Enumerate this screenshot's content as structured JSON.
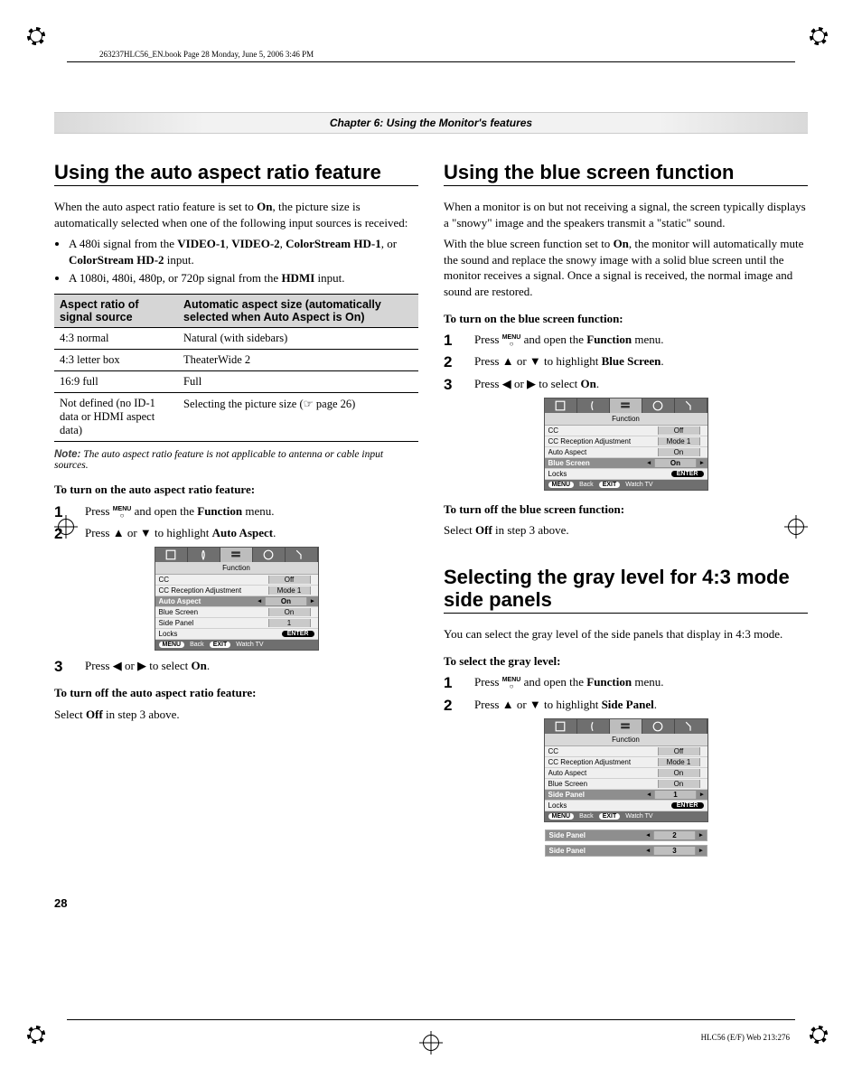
{
  "book_header": "263237HLC56_EN.book  Page 28  Monday, June 5, 2006  3:46 PM",
  "running_head": "Chapter 6: Using the Monitor's features",
  "page_number": "28",
  "footer_right": "HLC56 (E/F) Web 213:276",
  "left": {
    "h1": "Using the auto aspect ratio feature",
    "intro_a": "When the auto aspect ratio feature is set to ",
    "intro_b": "On",
    "intro_c": ", the picture size is automatically selected when one of the following input sources is received:",
    "bullets": [
      {
        "pre": "A 480i signal from the ",
        "b1": "VIDEO-1",
        "mid1": ", ",
        "b2": "VIDEO-2",
        "mid2": ", ",
        "b3": "ColorStream HD-1",
        "mid3": ", or ",
        "b4": "ColorStream HD-2",
        "post": " input."
      },
      {
        "pre": "A 1080i, 480i, 480p, or 720p signal from the ",
        "b1": "HDMI",
        "post": " input."
      }
    ],
    "table": {
      "col1": "Aspect ratio of signal source",
      "col2": "Automatic aspect size (automatically selected when Auto Aspect is On)",
      "rows": [
        {
          "c1": "4:3 normal",
          "c2": "Natural (with sidebars)"
        },
        {
          "c1": "4:3 letter box",
          "c2": "TheaterWide 2"
        },
        {
          "c1": "16:9 full",
          "c2": "Full"
        },
        {
          "c1": "Not defined (no ID-1 data or HDMI aspect data)",
          "c2": "Selecting the picture size (☞ page 26)"
        }
      ]
    },
    "note_label": "Note:",
    "note_text": " The auto aspect ratio feature is not applicable to antenna or cable input sources.",
    "instr_on": "To turn on the auto aspect ratio feature:",
    "steps": [
      {
        "a": "Press ",
        "menu": "MENU",
        "b": " and open the ",
        "bold": "Function",
        "c": " menu."
      },
      {
        "a": "Press ▲ or ▼ to highlight ",
        "bold": "Auto Aspect",
        "c": "."
      }
    ],
    "step3": {
      "a": "Press ◀ or ▶ to select ",
      "bold": "On",
      "c": "."
    },
    "instr_off": "To turn off the auto aspect ratio feature:",
    "off_text_a": "Select ",
    "off_text_b": "Off",
    "off_text_c": " in step 3 above.",
    "osd": {
      "title": "Function",
      "rows": [
        {
          "label": "CC",
          "value": "Off",
          "sel": false
        },
        {
          "label": "CC Reception Adjustment",
          "value": "Mode 1",
          "sel": false
        },
        {
          "label": "Auto Aspect",
          "value": "On",
          "sel": true,
          "arrows": true
        },
        {
          "label": "Blue Screen",
          "value": "On",
          "sel": false
        },
        {
          "label": "Side Panel",
          "value": "1",
          "sel": false
        },
        {
          "label": "Locks",
          "enter": true,
          "sel": false
        }
      ],
      "footer": {
        "menu": "MENU",
        "back": "Back",
        "exit": "EXIT",
        "watch": "Watch TV"
      }
    }
  },
  "right": {
    "sec1": {
      "h1": "Using the blue screen function",
      "p1": "When a monitor is on but not receiving a signal, the screen typically displays a \"snowy\" image and the speakers transmit a \"static\" sound.",
      "p2a": "With the blue screen function set to ",
      "p2b": "On",
      "p2c": ", the monitor will automatically mute the sound and replace the snowy image with a solid blue screen until the monitor receives a signal. Once a signal is received, the normal image and sound are restored.",
      "instr_on": "To turn on the blue screen function:",
      "steps": [
        {
          "a": "Press ",
          "menu": "MENU",
          "b": " and open the ",
          "bold": "Function",
          "c": " menu."
        },
        {
          "a": "Press ▲ or ▼ to highlight ",
          "bold": "Blue Screen",
          "c": "."
        },
        {
          "a": "Press ◀ or ▶ to select ",
          "bold": "On",
          "c": "."
        }
      ],
      "osd": {
        "title": "Function",
        "rows": [
          {
            "label": "CC",
            "value": "Off",
            "sel": false
          },
          {
            "label": "CC Reception Adjustment",
            "value": "Mode 1",
            "sel": false
          },
          {
            "label": "Auto Aspect",
            "value": "On",
            "sel": false
          },
          {
            "label": "Blue Screen",
            "value": "On",
            "sel": true,
            "arrows": true
          },
          {
            "label": "Locks",
            "enter": true,
            "sel": false
          }
        ],
        "footer": {
          "menu": "MENU",
          "back": "Back",
          "exit": "EXIT",
          "watch": "Watch TV"
        }
      },
      "instr_off": "To turn off the blue screen function:",
      "off_text_a": "Select ",
      "off_text_b": "Off",
      "off_text_c": " in step 3 above."
    },
    "sec2": {
      "h1": "Selecting the gray level for 4:3 mode side panels",
      "p1": "You can select the gray level of the side panels that display in 4:3 mode.",
      "instr": "To select the gray level:",
      "steps": [
        {
          "a": "Press ",
          "menu": "MENU",
          "b": " and open the ",
          "bold": "Function",
          "c": " menu."
        },
        {
          "a": "Press ▲ or ▼ to highlight ",
          "bold": "Side Panel",
          "c": "."
        }
      ],
      "osd": {
        "title": "Function",
        "rows": [
          {
            "label": "CC",
            "value": "Off",
            "sel": false
          },
          {
            "label": "CC Reception Adjustment",
            "value": "Mode 1",
            "sel": false
          },
          {
            "label": "Auto Aspect",
            "value": "On",
            "sel": false
          },
          {
            "label": "Blue Screen",
            "value": "On",
            "sel": false
          },
          {
            "label": "Side Panel",
            "value": "1",
            "sel": true,
            "arrows": true
          },
          {
            "label": "Locks",
            "enter": true,
            "sel": false
          }
        ],
        "footer": {
          "menu": "MENU",
          "back": "Back",
          "exit": "EXIT",
          "watch": "Watch TV"
        }
      },
      "extra_rows": [
        {
          "label": "Side Panel",
          "value": "2",
          "sel": true,
          "arrows": true
        },
        {
          "label": "Side Panel",
          "value": "3",
          "sel": true,
          "arrows": true
        }
      ]
    }
  }
}
